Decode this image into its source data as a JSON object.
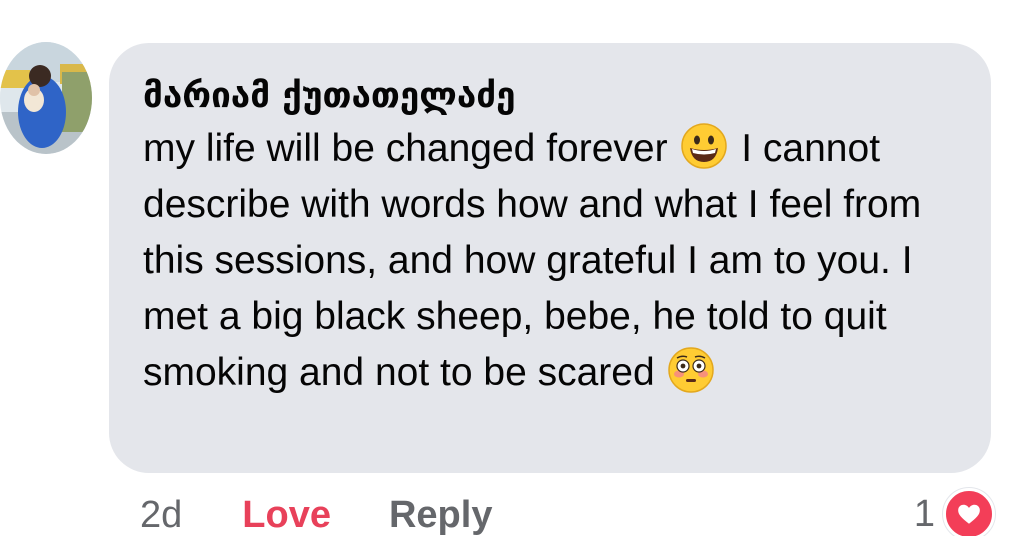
{
  "comment": {
    "author": "მარიამ ქუთათელაძე",
    "text_segments": [
      "my life will be changed forever ",
      " I cannot describe with words how and what I feel from this sessions, and how grateful I am to you. I met a big black sheep, bebe, he told to quit smoking and not to be scared "
    ],
    "emojis": [
      "grinning-face-emoji",
      "flushed-face-emoji"
    ]
  },
  "actions": {
    "time": "2d",
    "love_label": "Love",
    "reply_label": "Reply"
  },
  "reactions": {
    "count": "1",
    "icon": "heart-icon",
    "color": "#f33e58"
  },
  "colors": {
    "bubble": "#e4e6eb",
    "love_accent": "#e8415a",
    "muted": "#65676b",
    "text": "#050505"
  }
}
